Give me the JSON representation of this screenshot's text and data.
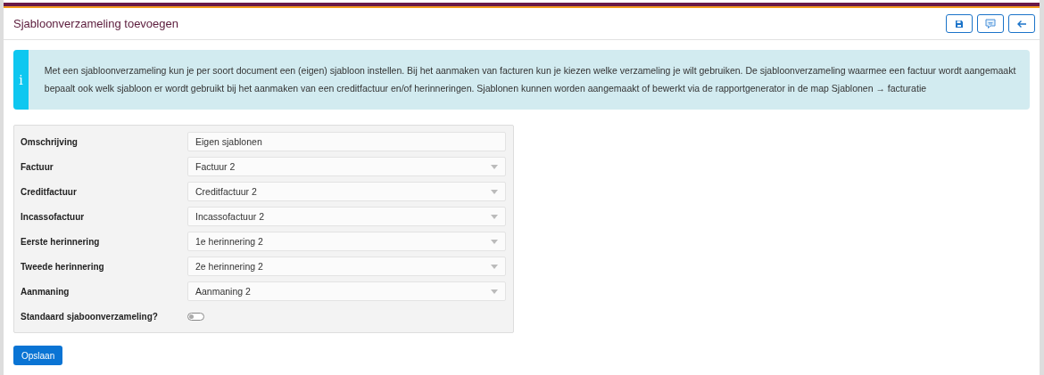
{
  "header": {
    "title": "Sjabloonverzameling toevoegen",
    "actions": [
      {
        "kind": "save"
      },
      {
        "kind": "comment"
      },
      {
        "kind": "back"
      }
    ]
  },
  "info": {
    "icon": "i",
    "text": "Met een sjabloonverzameling kun je per soort document een (eigen) sjabloon instellen. Bij het aanmaken van facturen kun je kiezen welke verzameling je wilt gebruiken. De sjabloonverzameling waarmee een factuur wordt aangemaakt bepaalt ook welk sjabloon er wordt gebruikt bij het aanmaken van een creditfactuur en/of herinneringen. Sjablonen kunnen worden aangemaakt of bewerkt via de rapportgenerator in de map Sjablonen → facturatie"
  },
  "form": [
    {
      "kind": "text",
      "label": "Omschrijving",
      "value": "Eigen sjablonen"
    },
    {
      "kind": "select",
      "label": "Factuur",
      "value": "Factuur 2"
    },
    {
      "kind": "select",
      "label": "Creditfactuur",
      "value": "Creditfactuur 2"
    },
    {
      "kind": "select",
      "label": "Incassofactuur",
      "value": "Incassofactuur 2"
    },
    {
      "kind": "select",
      "label": "Eerste herinnering",
      "value": "1e herinnering 2"
    },
    {
      "kind": "select",
      "label": "Tweede herinnering",
      "value": "2e herinnering 2"
    },
    {
      "kind": "select",
      "label": "Aanmaning",
      "value": "Aanmaning 2"
    },
    {
      "kind": "toggle",
      "label": "Standaard sjaboonverzameling?",
      "on": false
    }
  ],
  "save_button": "Opslaan"
}
